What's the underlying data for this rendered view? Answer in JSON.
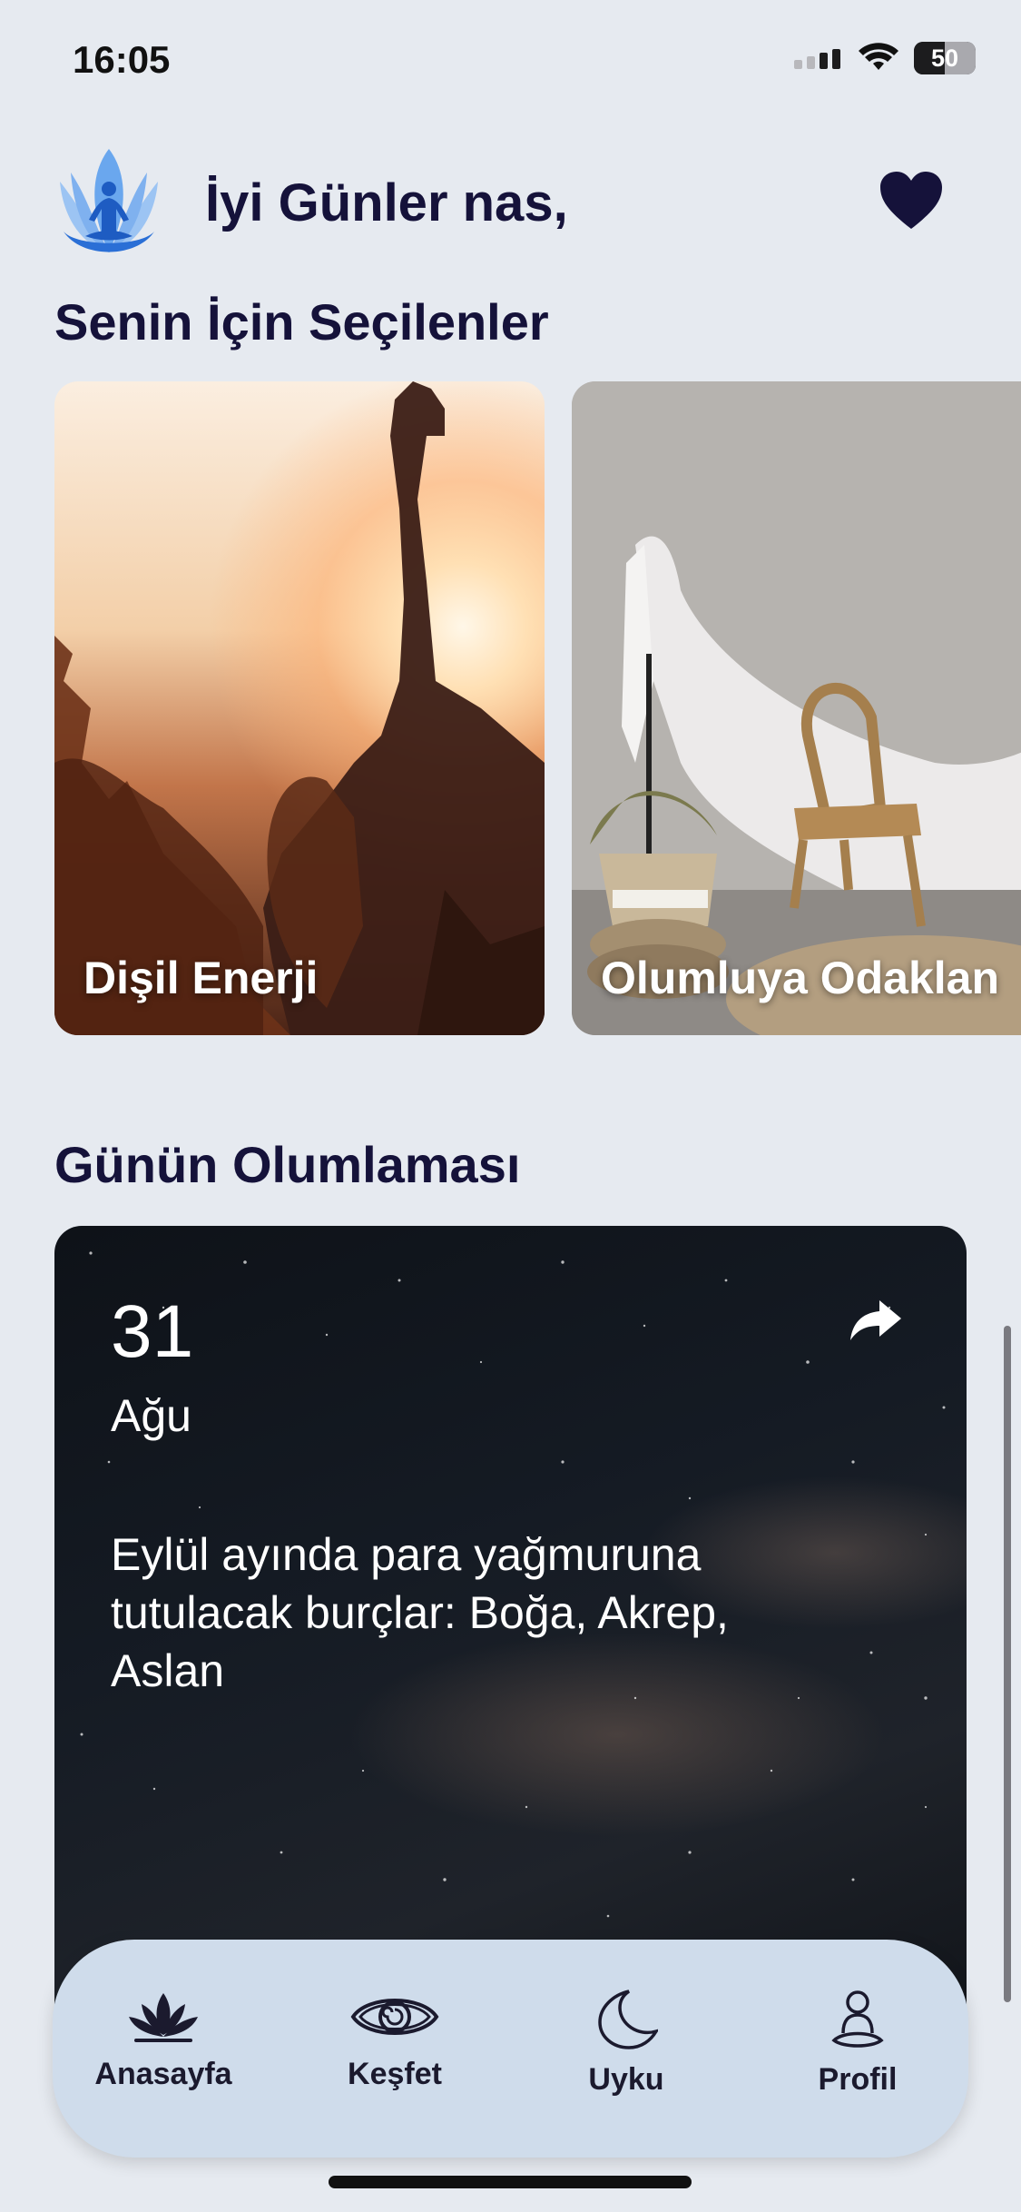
{
  "status_bar": {
    "time": "16:05",
    "battery_percent": 50,
    "battery_text": "50"
  },
  "header": {
    "greeting": "İyi Günler nas,"
  },
  "sections": {
    "for_you_title": "Senin İçin Seçilenler",
    "affirmation_title": "Günün Olumlaması"
  },
  "cards": [
    {
      "title": "Dişil Enerji"
    },
    {
      "title": "Olumluya Odaklan"
    }
  ],
  "affirmation": {
    "day": "31",
    "month": "Ağu",
    "text": "Eylül ayında para yağmuruna tutulacak burçlar: Boğa, Akrep, Aslan"
  },
  "tabbar": {
    "items": [
      {
        "label": "Anasayfa",
        "icon": "lotus-icon"
      },
      {
        "label": "Keşfet",
        "icon": "eye-icon"
      },
      {
        "label": "Uyku",
        "icon": "moon-icon"
      },
      {
        "label": "Profil",
        "icon": "person-meditating-icon"
      }
    ]
  },
  "colors": {
    "background": "#e6eaf0",
    "title": "#15123a",
    "tabbar": "#cfdceb",
    "logo": "#3a7de0"
  }
}
